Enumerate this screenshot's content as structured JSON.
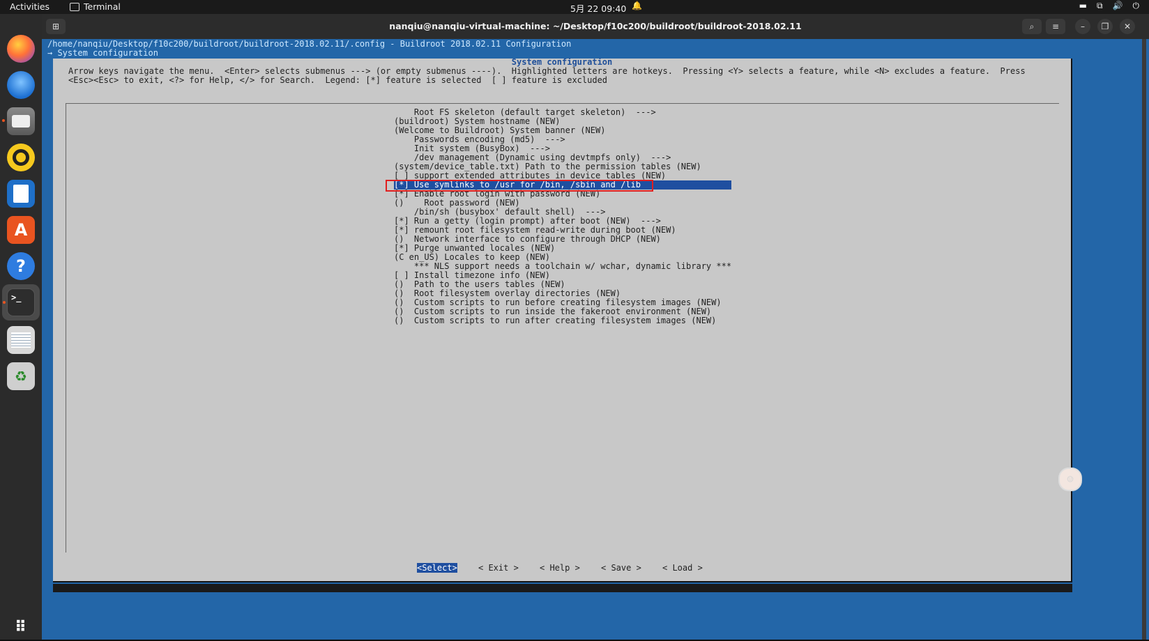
{
  "topbar": {
    "activities": "Activities",
    "app_name": "Terminal",
    "clock": "5月 22  09:40",
    "bell": "🔔",
    "tray_battery": "▬",
    "tray_network": "⧉",
    "tray_volume": "🔊",
    "tray_power": "⏻"
  },
  "dock": {
    "store_glyph": "A",
    "help_glyph": "?",
    "terminal_glyph": ">_",
    "trash_glyph": "♻",
    "grid_glyph": "⠿"
  },
  "window": {
    "title": "nanqiu@nanqiu-virtual-machine: ~/Desktop/f10c200/buildroot/buildroot-2018.02.11",
    "newtab_glyph": "⊞",
    "search_glyph": "⌕",
    "menu_glyph": "≡",
    "min_glyph": "–",
    "max_glyph": "❐",
    "close_glyph": "✕"
  },
  "terminal": {
    "path": "/home/nanqiu/Desktop/f10c200/buildroot/buildroot-2018.02.11/.config - Buildroot 2018.02.11 Configuration",
    "crumb": "→ System configuration",
    "dialog_title": "System configuration",
    "help_line1": "Arrow keys navigate the menu.  <Enter> selects submenus ---> (or empty submenus ----).  Highlighted letters are hotkeys.  Pressing <Y> selects a feature, while <N> excludes a feature.  Press",
    "help_line2": "<Esc><Esc> to exit, <?> for Help, </> for Search.  Legend: [*] feature is selected  [ ] feature is excluded",
    "menu": [
      "    Root FS skeleton (default target skeleton)  --->",
      "(buildroot) System hostname (NEW)",
      "(Welcome to Buildroot) System banner (NEW)",
      "    Passwords encoding (md5)  --->",
      "    Init system (BusyBox)  --->",
      "    /dev management (Dynamic using devtmpfs only)  --->",
      "(system/device_table.txt) Path to the permission tables (NEW)",
      "[ ] support extended attributes in device tables (NEW)",
      "[*] Use symlinks to /usr for /bin, /sbin and /lib",
      "[*] Enable root login with password (NEW)",
      "()    Root password (NEW)",
      "    /bin/sh (busybox' default shell)  --->",
      "[*] Run a getty (login prompt) after boot (NEW)  --->",
      "[*] remount root filesystem read-write during boot (NEW)",
      "()  Network interface to configure through DHCP (NEW)",
      "[*] Purge unwanted locales (NEW)",
      "(C en_US) Locales to keep (NEW)",
      "    *** NLS support needs a toolchain w/ wchar, dynamic library ***",
      "[ ] Install timezone info (NEW)",
      "()  Path to the users tables (NEW)",
      "()  Root filesystem overlay directories (NEW)",
      "()  Custom scripts to run before creating filesystem images (NEW)",
      "()  Custom scripts to run inside the fakeroot environment (NEW)",
      "()  Custom scripts to run after creating filesystem images (NEW)"
    ],
    "buttons": {
      "select": "<Select>",
      "exit": "< Exit >",
      "help": "< Help >",
      "save": "< Save >",
      "load": "< Load >"
    },
    "avatar_glyph": "☺"
  },
  "colors": {
    "terminal_bg": "#2366a8",
    "dialog_bg": "#c8c8c8",
    "selection_bg": "#1f4fa0",
    "annotation_box": "#e02020"
  }
}
